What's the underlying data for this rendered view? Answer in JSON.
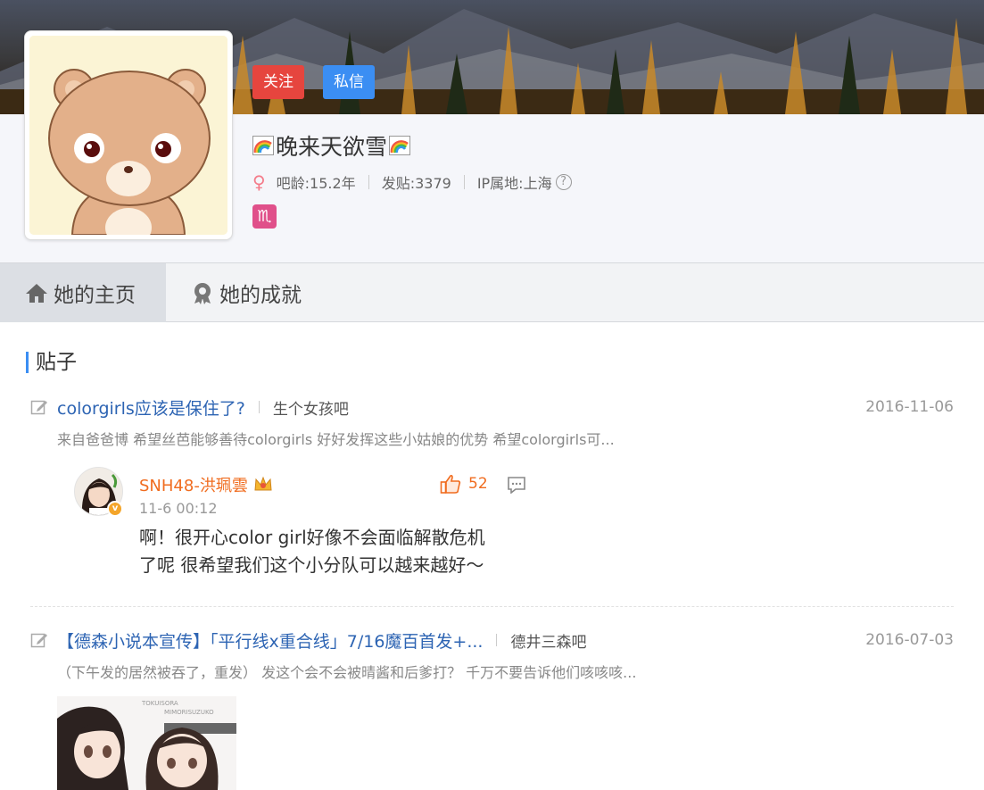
{
  "profile": {
    "follow_label": "关注",
    "message_label": "私信",
    "username": "晚来天欲雪",
    "bar_age": "吧龄:15.2年",
    "post_count": "发贴:3379",
    "ip_location": "IP属地:上海",
    "zodiac_symbol": "♏",
    "gender_icon": "female-icon"
  },
  "tabs": [
    {
      "label": "她的主页",
      "icon": "home-icon",
      "active": true
    },
    {
      "label": "她的成就",
      "icon": "medal-icon",
      "active": false
    }
  ],
  "section": {
    "title": "贴子"
  },
  "posts": [
    {
      "title": "colorgirls应该是保住了?",
      "forum": "生个女孩吧",
      "date": "2016-11-06",
      "excerpt": "来自爸爸博 希望丝芭能够善待colorgirls 好好发挥这些小姑娘的优势 希望colorgirls可...",
      "reply": {
        "name": "SNH48-洪珮雲",
        "time": "11-6 00:12",
        "likes": "52",
        "text_line1": "啊！很开心color girl好像不会面临解散危机",
        "text_line2": "了呢 很希望我们这个小分队可以越来越好～"
      }
    },
    {
      "title": "【德森小说本宣传】「平行线x重合线」7/16魔百首发+...",
      "forum": "德井三森吧",
      "date": "2016-07-03",
      "excerpt": "（下午发的居然被吞了，重发） 发这个会不会被晴酱和后爹打？ 千万不要告诉他们咳咳咳...",
      "thumb_caption_1": "TOKUISORA",
      "thumb_caption_2": "MIMORISUZUKO"
    }
  ],
  "colors": {
    "follow": "#e6453e",
    "message": "#3b8ef3",
    "link": "#2d64b3",
    "accent_orange": "#f06c1f"
  }
}
